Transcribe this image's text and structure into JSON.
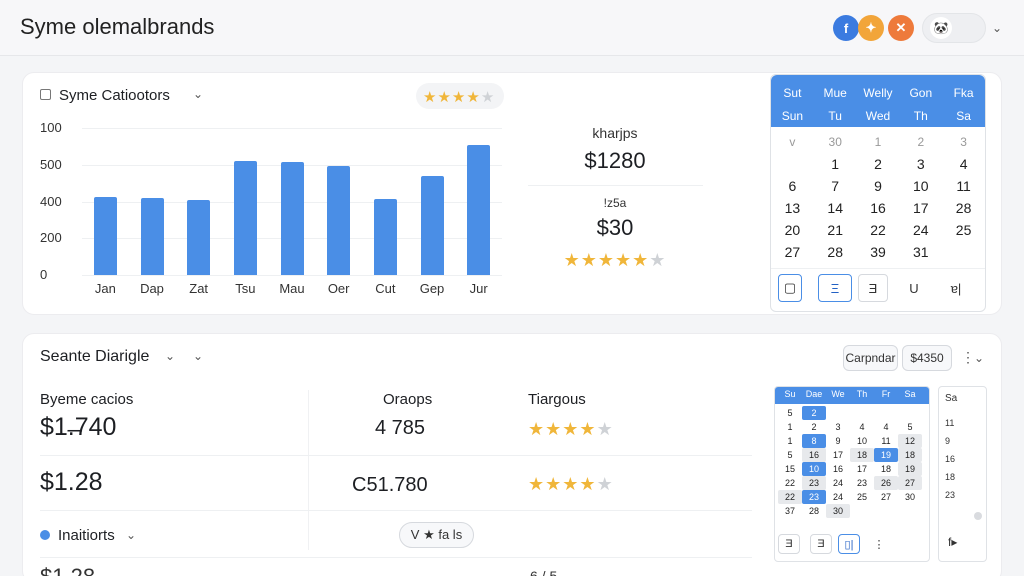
{
  "app": {
    "title": "Syme  olemalbrands"
  },
  "header_icons": [
    {
      "name": "facebook-icon",
      "glyph": "f",
      "color": "#3b7be0"
    },
    {
      "name": "fox-icon",
      "glyph": "🦊",
      "color": "#f2a53a"
    },
    {
      "name": "orange-app-icon",
      "glyph": "✕",
      "color": "#ee7a3b"
    }
  ],
  "sales_card": {
    "title": "Syme Catiootors",
    "rating": 4,
    "chart_data": {
      "type": "bar",
      "categories": [
        "Jan",
        "Dap",
        "Zat",
        "Tsu",
        "Mau",
        "Oer",
        "Cut",
        "Gep",
        "Jur"
      ],
      "values": [
        370,
        365,
        355,
        545,
        540,
        520,
        360,
        470,
        620
      ],
      "yticks": [
        "100",
        "500",
        "400",
        "200",
        "0"
      ],
      "ylim": [
        0,
        700
      ]
    },
    "summary": [
      {
        "label": "kharjps",
        "value": "$1280"
      },
      {
        "label": "!z5a",
        "value": "$30"
      }
    ],
    "summary_rating": 5
  },
  "calendar_big": {
    "row1": [
      "Sut",
      "Mue",
      "Welly",
      "Gon",
      "Fka"
    ],
    "row2": [
      "Sun",
      "Tu",
      "Wed",
      "Th",
      "Sa"
    ],
    "weeks": [
      [
        "v",
        "30",
        "1",
        "2",
        "3"
      ],
      [
        "",
        "1",
        "2",
        "3",
        "4"
      ],
      [
        "6",
        "7",
        "9",
        "10",
        "11"
      ],
      [
        "13",
        "14",
        "16",
        "17",
        "28"
      ],
      [
        "20",
        "21",
        "22",
        "24",
        "25"
      ],
      [
        "27",
        "28",
        "39",
        "31",
        ""
      ]
    ],
    "buttons": [
      "▢",
      "Ξ",
      "Ǝ",
      "U",
      "ɐ|"
    ]
  },
  "bottom_card": {
    "title": "Seante Diarigle",
    "col_headers": [
      "Byeme cacios",
      "Oraops",
      "Tiargous"
    ],
    "rows": [
      {
        "price": "$1.̶740",
        "count": "4 785",
        "rating": 4
      },
      {
        "price": "$1.28",
        "count": "Ϲ51.780",
        "rating": 4
      }
    ],
    "filter_label": "Inaitiorts",
    "filter_badge": "V ★ fa ls",
    "cut_price": "$1.28",
    "cut_text": "6 / 5"
  },
  "bottom_toolbar": {
    "btn1": "Carpndar",
    "btn2": "$4350",
    "more": "⋮"
  },
  "mini_calendar": {
    "headers": [
      "Su",
      "Dae",
      "We",
      "Th",
      "Fr",
      "Sa"
    ],
    "rows": [
      [
        "5",
        "2",
        "",
        "",
        "",
        ""
      ],
      [
        "1",
        "2",
        "3",
        "4",
        "4",
        "5"
      ],
      [
        "1",
        "8",
        "9",
        "10",
        "11",
        "12"
      ],
      [
        "5",
        "16",
        "17",
        "18",
        "19",
        "18"
      ],
      [
        "15",
        "10",
        "16",
        "17",
        "18",
        "19"
      ],
      [
        "22",
        "23",
        "24",
        "23",
        "26",
        "27"
      ],
      [
        "22",
        "23",
        "24",
        "25",
        "27",
        "30"
      ],
      [
        "37",
        "28",
        "30",
        "",
        "",
        ""
      ]
    ],
    "buttons": [
      "Ǝ",
      "Ǝ",
      "▯|",
      "⋮"
    ]
  },
  "side_panel": {
    "items": [
      "Sa",
      "11",
      "9",
      "16",
      "18",
      "23"
    ],
    "button": "f▸"
  }
}
